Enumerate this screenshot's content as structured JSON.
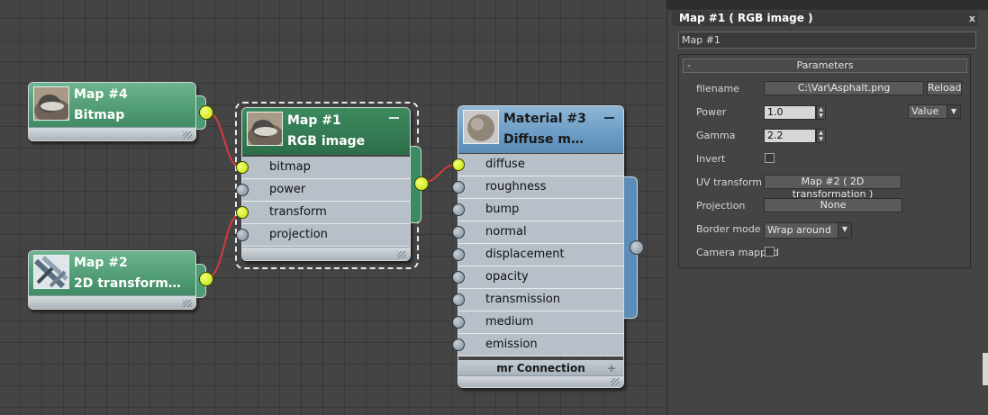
{
  "nodes": {
    "map4": {
      "title": "Map #4",
      "subtitle": "Bitmap"
    },
    "map2": {
      "title": "Map #2",
      "subtitle": "2D  transform…"
    },
    "map1": {
      "title": "Map #1",
      "subtitle": "RGB image",
      "inputs": [
        {
          "label": "bitmap",
          "connected": true
        },
        {
          "label": "power",
          "connected": false
        },
        {
          "label": "transform",
          "connected": true
        },
        {
          "label": "projection",
          "connected": false
        }
      ]
    },
    "material3": {
      "title": "Material #3",
      "subtitle": "Diffuse  m…",
      "inputs": [
        {
          "label": "diffuse",
          "connected": true
        },
        {
          "label": "roughness",
          "connected": false
        },
        {
          "label": "bump",
          "connected": false
        },
        {
          "label": "normal",
          "connected": false
        },
        {
          "label": "displacement",
          "connected": false
        },
        {
          "label": "opacity",
          "connected": false
        },
        {
          "label": "transmission",
          "connected": false
        },
        {
          "label": "medium",
          "connected": false
        },
        {
          "label": "emission",
          "connected": false
        }
      ],
      "footer": "mr Connection",
      "footer_plus": "+"
    }
  },
  "panel": {
    "title": "Map #1  ( RGB image )",
    "close": "x",
    "name_value": "Map #1",
    "rollout": {
      "title": "Parameters",
      "toggle": "-"
    },
    "params": {
      "filename_label": "filename",
      "filename_value": "C:\\Var\\Asphalt.png",
      "reload": "Reload",
      "power_label": "Power",
      "power_value": "1.0",
      "power_mode": "Value",
      "gamma_label": "Gamma",
      "gamma_value": "2.2",
      "invert_label": "Invert",
      "invert_checked": false,
      "uv_label": "UV transform",
      "uv_value": "Map #2  ( 2D transformation )",
      "projection_label": "Projection",
      "projection_value": "None",
      "border_label": "Border mode",
      "border_value": "Wrap around",
      "camera_label": "Camera mapped",
      "camera_checked": false
    }
  },
  "colors": {
    "wire": "#d83a3a",
    "socket_connected": "#d4f000",
    "node_green": "#4e9a72",
    "node_blue": "#6a9bc4"
  }
}
